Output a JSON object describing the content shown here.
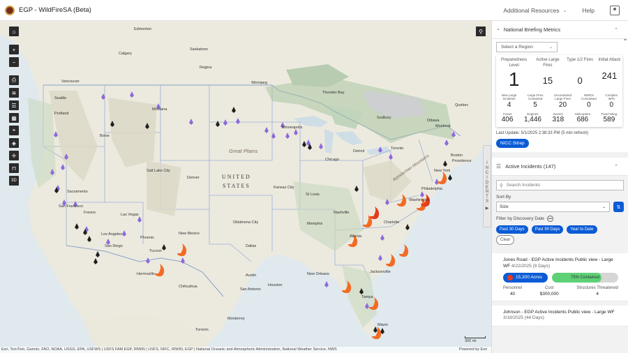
{
  "header": {
    "title": "EGP - WildFireSA (Beta)",
    "nav": [
      {
        "label": "Additional Resources"
      },
      {
        "label": "Help"
      }
    ]
  },
  "map": {
    "attribution": "Esri, TomTom, Garmin, FAO, NOAA, USGS, EPA, USFWS | USFS FAM EGP, IRWIN | USFS, NIFC, IRWIN, EGP | National Oceanic and Atmospheric Administration, National Weather Service, NWS",
    "powered_by": "Powered by Esri",
    "scale_label": "300 mi",
    "side_tab_letters": [
      "I",
      "N",
      "C",
      "I",
      "D",
      "E",
      "N",
      "T",
      "S"
    ],
    "tools": [
      "home-icon",
      "zoom-in-icon",
      "zoom-out-icon",
      "print-icon",
      "layers-icon",
      "list-icon",
      "grid-icon",
      "location-icon",
      "compass-icon",
      "crosshair-icon",
      "measure-icon",
      "3d-icon"
    ],
    "tool_3d_label": "3D",
    "labels": {
      "country": "UNITED\nSTATES",
      "regions": [
        "Great Plains",
        "Appalachian Mountains"
      ],
      "cities": [
        "Edmonton",
        "Saskatoon",
        "Regina",
        "Calgary",
        "Vancouver",
        "Seattle",
        "Portland",
        "Boise",
        "Montana",
        "Sacramento",
        "San Francisco",
        "Fresno",
        "Los Angeles",
        "San Diego",
        "Las Vegas",
        "Phoenix",
        "Tucson",
        "Denver",
        "Salt Lake City",
        "New Mexico",
        "Oklahoma City",
        "Dallas",
        "Houston",
        "San Antonio",
        "Austin",
        "Kansas City",
        "St Louis",
        "Chicago",
        "Detroit",
        "Minneapolis",
        "Memphis",
        "Atlanta",
        "Nashville",
        "Jacksonville",
        "Tampa",
        "Miami",
        "Charlotte",
        "Washington",
        "New York",
        "Boston",
        "Toronto",
        "Ottawa",
        "Montreal",
        "Quebec",
        "Providence",
        "Philadelphia",
        "New Orleans",
        "Chihuahua",
        "Monterrey",
        "Torreón",
        "Hermosillo",
        "Winnipeg",
        "Thunder Bay",
        "Sudbury",
        "North Dakota",
        "South Dakota",
        "Nebraska",
        "Wyoming",
        "Nevada",
        "Utah",
        "Kentucky",
        "Ohio",
        "Regina"
      ]
    }
  },
  "panel": {
    "briefing": {
      "title": "National Briefing Metrics",
      "region_placeholder": "Select a Region",
      "top": [
        {
          "label": "Preparedness Level",
          "value": "1"
        },
        {
          "label": "Active Large Fires",
          "value": "15"
        },
        {
          "label": "Type 1/2 Fires",
          "value": "0"
        },
        {
          "label": "Initial Attack",
          "value": "241"
        }
      ],
      "mid": [
        {
          "label": "New Large Incidents",
          "value": "4"
        },
        {
          "label": "Large Fires Contained",
          "value": "5"
        },
        {
          "label": "Uncontained Large Fires",
          "value": "20"
        },
        {
          "label": "NIMOs Committed",
          "value": "0"
        },
        {
          "label": "Complex IMTs",
          "value": "0"
        }
      ],
      "bottom": [
        {
          "label": "Crews",
          "value": "406"
        },
        {
          "label": "Engines",
          "value": "1,446"
        },
        {
          "label": "Dozers",
          "value": "318"
        },
        {
          "label": "Helicopters",
          "value": "686"
        },
        {
          "label": "Fixed Wing",
          "value": "589"
        }
      ],
      "last_update": "Last Update: 5/1/2025 2:38:33 PM (5 min refresh)",
      "sitrep_button": "NICC Sitrep"
    },
    "incidents": {
      "title": "Active Incidents (147)",
      "search_placeholder": "Search Incidents",
      "sort_by_label": "Sort By",
      "sort_value": "Size",
      "filter_label": "Filter by Discovery Date",
      "chips": [
        "Past 30 Days",
        "Past 90 Days",
        "Year to Date"
      ],
      "clear_label": "Clear",
      "cards": [
        {
          "title": "Jones Road - EGP Active Incidents Public view - Large WF",
          "date": "4/22/2025 (9 Days)",
          "acres": "15,300 Acres",
          "contained_label": "75% Contained",
          "contained_pct": 75,
          "personnel_label": "Personnel",
          "personnel": "40",
          "cost_label": "Cost",
          "cost": "$300,000",
          "structures_label": "Structures Threatened",
          "structures": "4"
        },
        {
          "title": "Johnson - EGP Active Incidents Public view - Large WF",
          "date": "3/18/2025 (44 Days)"
        }
      ]
    }
  },
  "colors": {
    "accent": "#0b5bd6",
    "fire": "#e63b1f",
    "fire_purple": "#8e6ad9",
    "contained": "#5ed177"
  }
}
